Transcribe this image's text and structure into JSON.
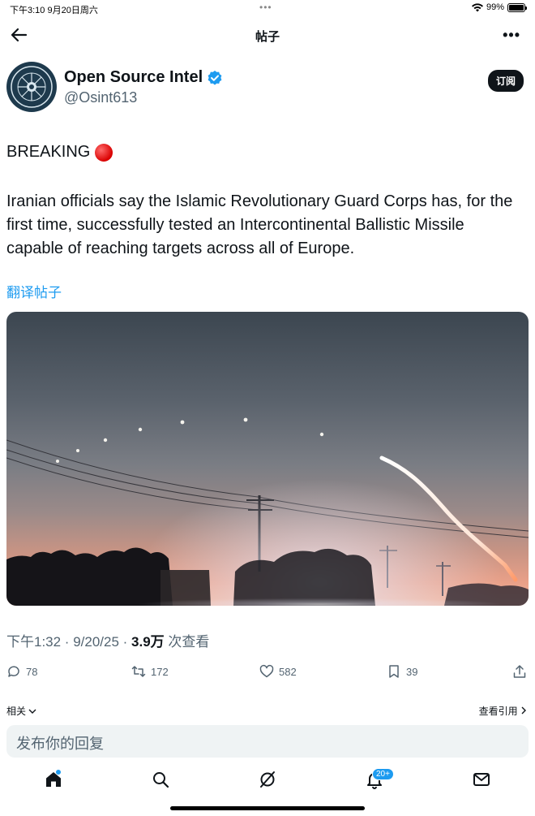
{
  "status_bar": {
    "time": "下午3:10  9月20日周六",
    "dots": "•••",
    "battery": "99%",
    "battery_level": 0.99
  },
  "nav": {
    "title": "帖子",
    "more": "•••"
  },
  "author": {
    "name": "Open Source Intel",
    "handle": "@Osint613",
    "subscribe_label": "订阅"
  },
  "tweet": {
    "headline": "BREAKING",
    "text": "Iranian officials say the Islamic Revolutionary Guard Corps has, for the first time, successfully tested an Intercontinental Ballistic Missile capable of reaching targets across all of Europe.",
    "translate_label": "翻译帖子"
  },
  "meta": {
    "time": "下午1:32 · 9/20/25 · ",
    "views": "3.9万",
    "views_label": " 次查看"
  },
  "actions": {
    "replies": "78",
    "reposts": "172",
    "likes": "582",
    "bookmarks": "39"
  },
  "related_label": "相关",
  "quotes_label": "查看引用",
  "reply_placeholder": "发布你的回复",
  "tabs": {
    "notifications_badge": "20+"
  },
  "colors": {
    "accent": "#1d9bf0",
    "verified": "#1d9bf0",
    "text": "#0f1419",
    "muted": "#536471"
  }
}
